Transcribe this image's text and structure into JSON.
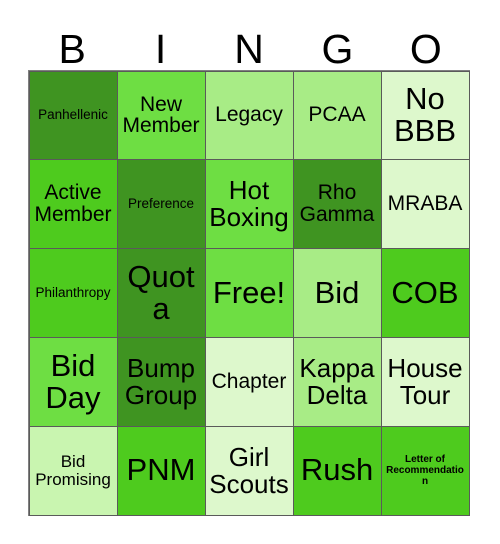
{
  "card": {
    "type": "bingo-card",
    "columns": 5,
    "rows": 5,
    "header_letters": [
      "B",
      "I",
      "N",
      "G",
      "O"
    ],
    "free_space_label": "Free!",
    "palette": {
      "dark_green": "#3f9421",
      "mid_green": "#4ecb1e",
      "green": "#6ede43",
      "light_green": "#a8ec86",
      "pale_green": "#c9f5b0",
      "very_pale_green": "#ddf8cc",
      "border": "#5a5a5a",
      "text": "#000000",
      "background": "#ffffff"
    },
    "cells": [
      {
        "text": "Panhellenic",
        "size": "sz-s",
        "color": "#3f9421"
      },
      {
        "text": "New Member",
        "size": "sz-l",
        "color": "#6ede43"
      },
      {
        "text": "Legacy",
        "size": "sz-l",
        "color": "#a8ec86"
      },
      {
        "text": "PCAA",
        "size": "sz-l",
        "color": "#a8ec86"
      },
      {
        "text": "No BBB",
        "size": "sz-xxl",
        "color": "#ddf8cc"
      },
      {
        "text": "Active Member",
        "size": "sz-l",
        "color": "#4ecb1e"
      },
      {
        "text": "Preference",
        "size": "sz-s",
        "color": "#3f9421"
      },
      {
        "text": "Hot Boxing",
        "size": "sz-xl",
        "color": "#6ede43"
      },
      {
        "text": "Rho Gamma",
        "size": "sz-l",
        "color": "#3f9421"
      },
      {
        "text": "MRABA",
        "size": "sz-l",
        "color": "#ddf8cc"
      },
      {
        "text": "Philanthropy",
        "size": "sz-s",
        "color": "#4ecb1e"
      },
      {
        "text": "Quota",
        "size": "sz-xxl",
        "color": "#3f9421"
      },
      {
        "text": "Free!",
        "size": "sz-xxl",
        "color": "#6ede43"
      },
      {
        "text": "Bid",
        "size": "sz-xxl",
        "color": "#a8ec86"
      },
      {
        "text": "COB",
        "size": "sz-xxl",
        "color": "#4ecb1e"
      },
      {
        "text": "Bid Day",
        "size": "sz-xxl",
        "color": "#6ede43"
      },
      {
        "text": "Bump Group",
        "size": "sz-xl",
        "color": "#3f9421"
      },
      {
        "text": "Chapter",
        "size": "sz-l",
        "color": "#ddf8cc"
      },
      {
        "text": "Kappa Delta",
        "size": "sz-xl",
        "color": "#a8ec86"
      },
      {
        "text": "House Tour",
        "size": "sz-xl",
        "color": "#ddf8cc"
      },
      {
        "text": "Bid Promising",
        "size": "sz-m",
        "color": "#c9f5b0"
      },
      {
        "text": "PNM",
        "size": "sz-xxl",
        "color": "#4ecb1e"
      },
      {
        "text": "Girl Scouts",
        "size": "sz-xl",
        "color": "#ddf8cc"
      },
      {
        "text": "Rush",
        "size": "sz-xxl",
        "color": "#4ecb1e"
      },
      {
        "text": "Letter of Recommendation",
        "size": "sz-xs",
        "color": "#4ecb1e"
      }
    ]
  }
}
